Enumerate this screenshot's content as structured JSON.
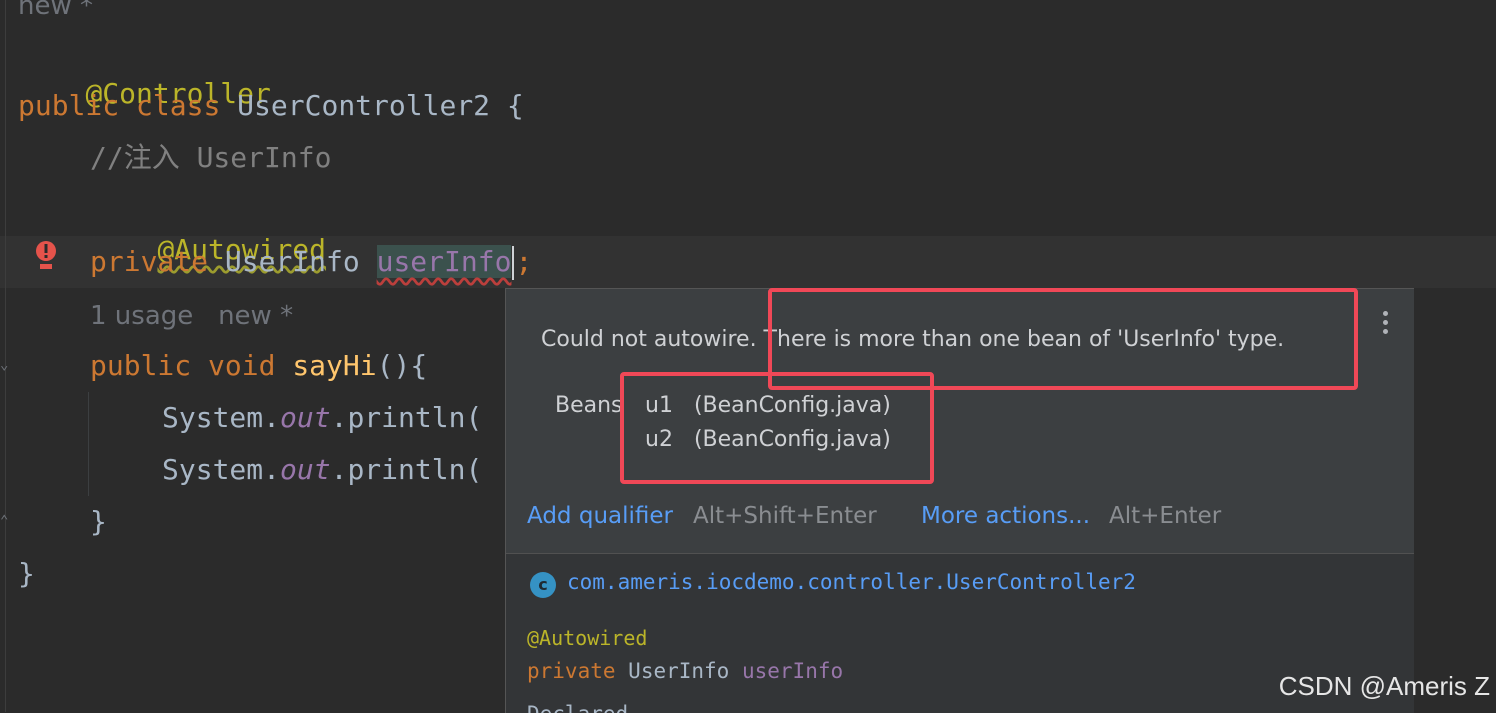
{
  "editor": {
    "top_hint": "new *",
    "lines": {
      "annotation_controller": "@Controller",
      "class_public": "public",
      "class_kw": "class",
      "class_name": "UserController2 {",
      "comment": "//注入 UserInfo",
      "annotation_autowired": "@Autowired",
      "field_private": "private",
      "field_type": "UserInfo",
      "field_name": "userInfo",
      "field_semicolon": ";",
      "usage_hint": "1 usage",
      "new_hint": "new *",
      "method_public": "public",
      "method_void": "void",
      "method_name": "sayHi",
      "method_rest": "(){",
      "println1_prefix": "System.",
      "println1_out": "out",
      "println1_suffix": ".println(",
      "println2_prefix": "System.",
      "println2_out": "out",
      "println2_suffix": ".println(",
      "method_close": "}",
      "class_close": "}"
    },
    "error_icon": "error-icon",
    "colors": {
      "background": "#2b2b2b",
      "keyword": "#cc7832",
      "annotation": "#bbb529",
      "field": "#9876aa",
      "method": "#ffc66d",
      "comment": "#808080"
    }
  },
  "popup": {
    "message": "Could not autowire. There is more than one bean of 'UserInfo' type.",
    "beans_label": "Beans",
    "beans": [
      {
        "name": "u1",
        "source": "(BeanConfig.java)"
      },
      {
        "name": "u2",
        "source": "(BeanConfig.java)"
      }
    ],
    "actions": [
      {
        "label": "Add qualifier",
        "shortcut": "Alt+Shift+Enter"
      },
      {
        "label": "More actions...",
        "shortcut": "Alt+Enter"
      }
    ],
    "doc": {
      "class_icon_letter": "c",
      "fqn": "com.ameris.iocdemo.controller.UserController2",
      "annotation": "@Autowired",
      "decl_kw": "private",
      "decl_type": "UserInfo",
      "decl_name": "userInfo",
      "cut_text": "Declared"
    },
    "menu_icon": "more-vertical-icon"
  },
  "highlight_color": "#f04857",
  "watermark": "CSDN @Ameris Z"
}
